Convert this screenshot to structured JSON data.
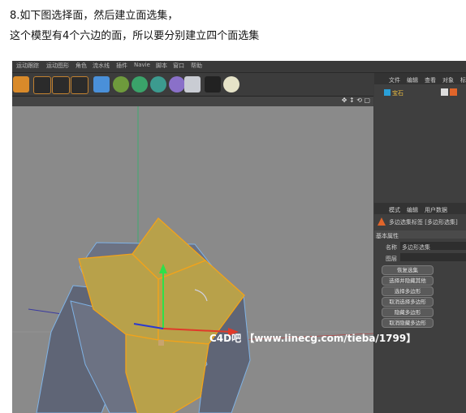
{
  "captions": {
    "line1": "8.如下图选择面，然后建立面选集，",
    "line2": "这个模型有4个六边的面，所以要分别建立四个面选集"
  },
  "menu": [
    "运动跟踪",
    "运动图形",
    "角色",
    "流水线",
    "插件",
    "Navie",
    "脚本",
    "窗口",
    "帮助"
  ],
  "object_manager": {
    "tabs": [
      "文件",
      "编辑",
      "查看",
      "对象",
      "标"
    ],
    "object_name": "宝石"
  },
  "attributes": {
    "tabs": [
      "模式",
      "编辑",
      "用户数据"
    ],
    "tag_title": "多边选集标签 [多边形选集]",
    "section": "基本属性",
    "name_label": "名称",
    "name_value": "多边形选集",
    "layer_label": "图层",
    "buttons": [
      "恢复选集",
      "选择并隐藏其他",
      "选择多边形",
      "取消选择多边形",
      "隐藏多边形",
      "取消隐藏多边形"
    ]
  },
  "watermark": "C4D吧 【www.linecg.com/tieba/1799】",
  "colors": {
    "selected_face": "#b8a14a",
    "face": "#6c7283",
    "edge_selected": "#f2a31b",
    "edge": "#7fb3e6"
  }
}
